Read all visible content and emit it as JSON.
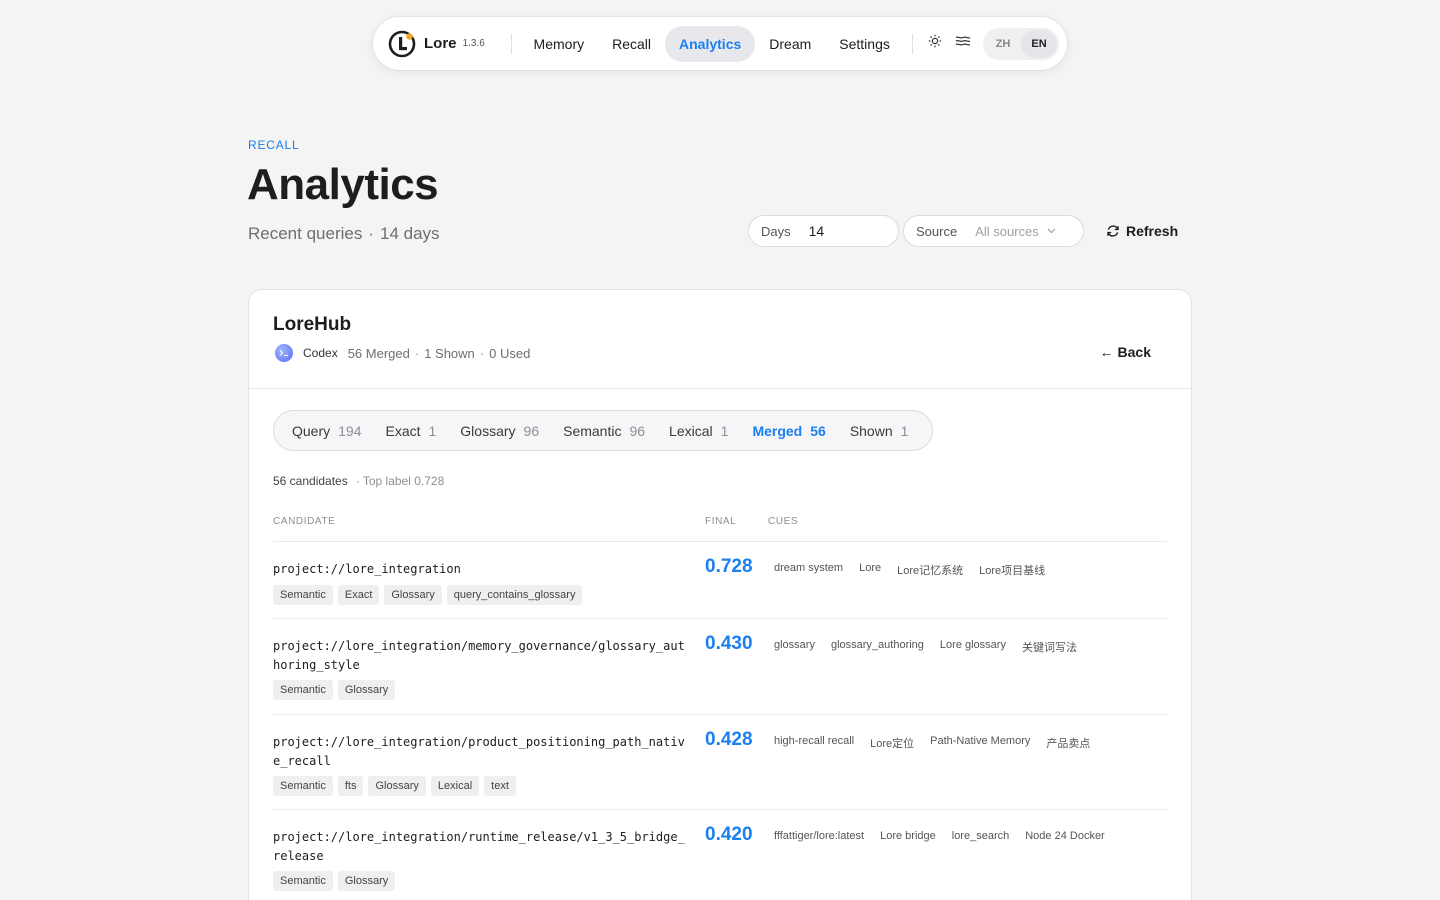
{
  "app": {
    "name": "Lore",
    "version": "1.3.6",
    "accent": "#1a7ff0",
    "nav": [
      {
        "label": "Memory"
      },
      {
        "label": "Recall"
      },
      {
        "label": "Analytics",
        "active": true
      },
      {
        "label": "Dream"
      },
      {
        "label": "Settings"
      }
    ],
    "icons": [
      "sun-icon",
      "wave-icon"
    ],
    "lang": {
      "zh": "ZH",
      "en": "EN",
      "selected": "EN"
    }
  },
  "header": {
    "eyebrow": "RECALL",
    "title": "Analytics",
    "subtitle_a": "Recent queries",
    "subtitle_sep": "·",
    "subtitle_b": "14 days"
  },
  "filters": {
    "days_label": "Days",
    "days_value": "14",
    "source_label": "Source",
    "source_value": "All sources",
    "refresh_label": "Refresh"
  },
  "detail": {
    "title": "LoreHub",
    "agent": "Codex",
    "merged": "56 Merged",
    "shown": "1 Shown",
    "used": "0 Used",
    "sep": "·",
    "back_label": "← Back",
    "tabs": [
      {
        "label": "Query",
        "count": "194"
      },
      {
        "label": "Exact",
        "count": "1"
      },
      {
        "label": "Glossary",
        "count": "96"
      },
      {
        "label": "Semantic",
        "count": "96"
      },
      {
        "label": "Lexical",
        "count": "1"
      },
      {
        "label": "Merged",
        "count": "56",
        "active": true
      },
      {
        "label": "Shown",
        "count": "1"
      }
    ],
    "candidates": "56 candidates",
    "top_label": "· Top label 0.728",
    "columns": {
      "candidate": "CANDIDATE",
      "final": "FINAL",
      "cues": "CUES"
    },
    "rows": [
      {
        "path": "project://lore_integration",
        "score": "0.728",
        "cues": [
          "dream system",
          "Lore",
          "Lore记忆系统",
          "Lore项目基线"
        ],
        "tags": [
          "Semantic",
          "Exact",
          "Glossary",
          "query_contains_glossary"
        ]
      },
      {
        "path": "project://lore_integration/memory_governance/glossary_authoring_style",
        "score": "0.430",
        "cues": [
          "glossary",
          "glossary_authoring",
          "Lore glossary",
          "关键词写法"
        ],
        "tags": [
          "Semantic",
          "Glossary"
        ]
      },
      {
        "path": "project://lore_integration/product_positioning_path_native_recall",
        "score": "0.428",
        "cues": [
          "high-recall recall",
          "Lore定位",
          "Path-Native Memory",
          "产品卖点"
        ],
        "tags": [
          "Semantic",
          "fts",
          "Glossary",
          "Lexical",
          "text"
        ]
      },
      {
        "path": "project://lore_integration/runtime_release/v1_3_5_bridge_release",
        "score": "0.420",
        "cues": [
          "fffattiger/lore:latest",
          "Lore bridge",
          "lore_search",
          "Node 24 Docker"
        ],
        "tags": [
          "Semantic",
          "Glossary"
        ]
      }
    ]
  }
}
